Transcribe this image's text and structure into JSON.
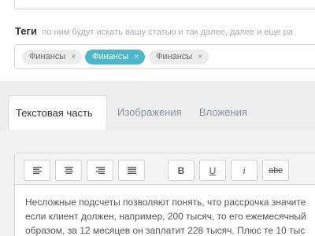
{
  "tags": {
    "label": "Теги",
    "hint": "по ним будут искать вашу статью и так далее, далее и еще ра",
    "items": [
      {
        "text": "Финансы",
        "remove": "×",
        "style": "gray"
      },
      {
        "text": "Финансы",
        "remove": "×",
        "style": "blue"
      },
      {
        "text": "Финансы",
        "remove": "×",
        "style": "gray"
      }
    ]
  },
  "tabs": [
    {
      "label": "Текстовая часть",
      "active": true
    },
    {
      "label": "Изображения",
      "active": false
    },
    {
      "label": "Вложения",
      "active": false
    }
  ],
  "toolbar": {
    "align_left": "align-left-icon",
    "align_center": "align-center-icon",
    "align_right": "align-right-icon",
    "justify": "justify-icon",
    "bold": "B",
    "underline": "U",
    "italic": "i",
    "strike": "abc"
  },
  "editor": {
    "lines": [
      "Несложные подсчеты позволяют понять, что рассрочка значите",
      "если клиент должен, например, 200 тысяч, то его ежемесячный",
      "образом, за 12 месяцев он заплатит 228 тысяч. Плюс те 10 тыс"
    ]
  },
  "colors": {
    "accent": "#4bb7c8",
    "tab_band": "#eeeeee",
    "tag_gray": "#ececec"
  }
}
